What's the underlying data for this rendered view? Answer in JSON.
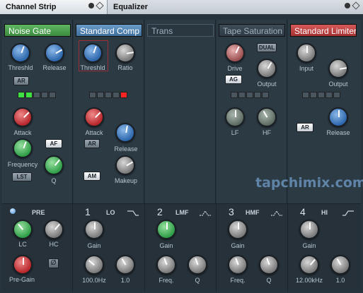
{
  "tabs": {
    "channel_strip": "Channel Strip",
    "equalizer": "Equalizer"
  },
  "modules": {
    "noise_gate": {
      "title": "Noise Gate",
      "threshold": "Threshld",
      "release": "Release",
      "ar": "AR",
      "attack": "Attack",
      "frequency": "Frequency",
      "af": "AF",
      "lst": "LST",
      "q": "Q"
    },
    "comp": {
      "title": "Standard Comp",
      "threshold": "Threshld",
      "ratio": "Ratio",
      "attack": "Attack",
      "ar": "AR",
      "release": "Release",
      "am": "AM",
      "makeup": "Makeup"
    },
    "trans": {
      "title": "Trans"
    },
    "tape": {
      "title": "Tape Saturation",
      "dual": "DUAL",
      "drive": "Drive",
      "ag": "AG",
      "output": "Output",
      "lf": "LF",
      "hf": "HF"
    },
    "limiter": {
      "title": "Standard Limiter",
      "input": "Input",
      "output": "Output",
      "ar": "AR",
      "release": "Release"
    }
  },
  "watermark": "tapchimix.com",
  "eq": {
    "pre": {
      "title": "PRE",
      "lc": "LC",
      "hc": "HC",
      "pre_gain": "Pre-Gain",
      "phase": "Ø"
    },
    "bands": [
      {
        "num": "1",
        "name": "LO",
        "gain": "Gain",
        "freq": "100.0Hz",
        "q": "1.0"
      },
      {
        "num": "2",
        "name": "LMF",
        "gain": "Gain",
        "freq": "Freq.",
        "q": "Q"
      },
      {
        "num": "3",
        "name": "HMF",
        "gain": "Gain",
        "freq": "Freq.",
        "q": "Q"
      },
      {
        "num": "4",
        "name": "HI",
        "gain": "Gain",
        "freq": "12.00kHz",
        "q": "1.0"
      }
    ]
  }
}
